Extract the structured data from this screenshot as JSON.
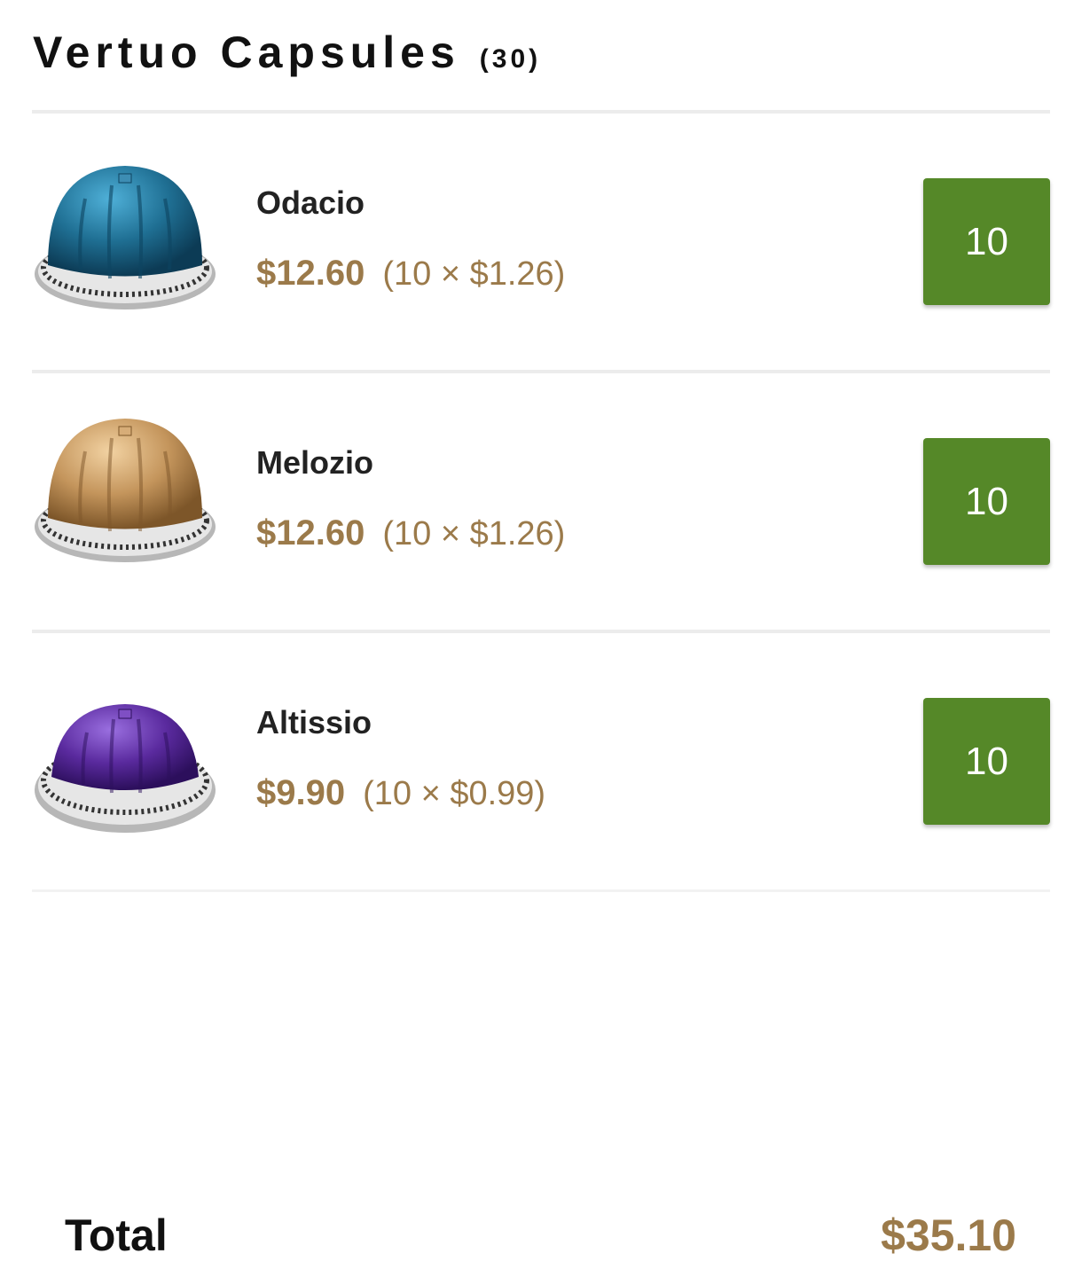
{
  "header": {
    "title": "Vertuo Capsules",
    "count": "(30)"
  },
  "items": [
    {
      "name": "Odacio",
      "price": "$12.60",
      "detail": "(10 × $1.26)",
      "quantity": "10",
      "capsule_color": "#1f6f93"
    },
    {
      "name": "Melozio",
      "price": "$12.60",
      "detail": "(10 × $1.26)",
      "quantity": "10",
      "capsule_color": "#c4955c"
    },
    {
      "name": "Altissio",
      "price": "$9.90",
      "detail": "(10 × $0.99)",
      "quantity": "10",
      "capsule_color": "#5a2a9e"
    }
  ],
  "footer": {
    "total_label": "Total",
    "total_value": "$35.10"
  },
  "colors": {
    "accent_button": "#558828",
    "price_gold": "#9b7a4a"
  }
}
